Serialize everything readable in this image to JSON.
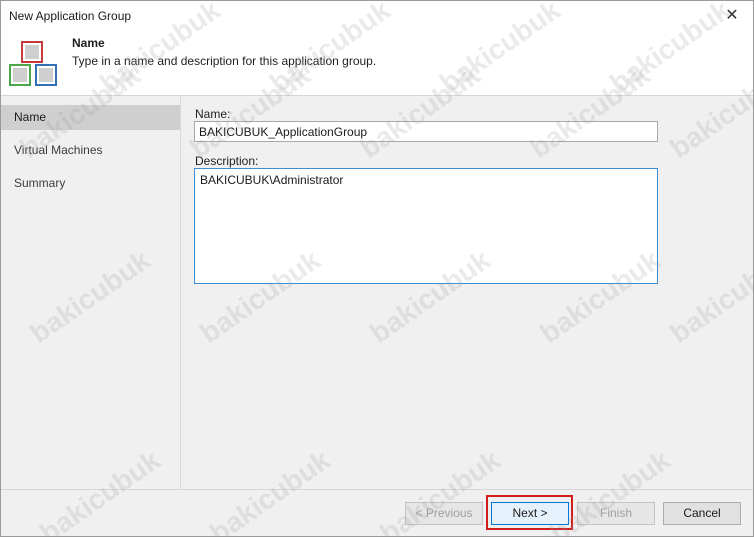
{
  "window": {
    "title": "New Application Group",
    "close_label": "✕"
  },
  "header": {
    "title": "Name",
    "subtitle": "Type in a name and description for this application group."
  },
  "sidebar": {
    "items": [
      {
        "label": "Name",
        "active": true
      },
      {
        "label": "Virtual Machines",
        "active": false
      },
      {
        "label": "Summary",
        "active": false
      }
    ]
  },
  "form": {
    "name_label": "Name:",
    "name_value": "BAKICUBUK_ApplicationGroup",
    "description_label": "Description:",
    "description_value": "BAKICUBUK\\Administrator"
  },
  "footer": {
    "previous_label": "< Previous",
    "next_label": "Next >",
    "finish_label": "Finish",
    "cancel_label": "Cancel"
  },
  "watermark": {
    "text": "bakicubuk"
  },
  "colors": {
    "highlight": "#d11d1d",
    "focus": "#0078d7",
    "sidebar_active": "#cfcfcf"
  }
}
